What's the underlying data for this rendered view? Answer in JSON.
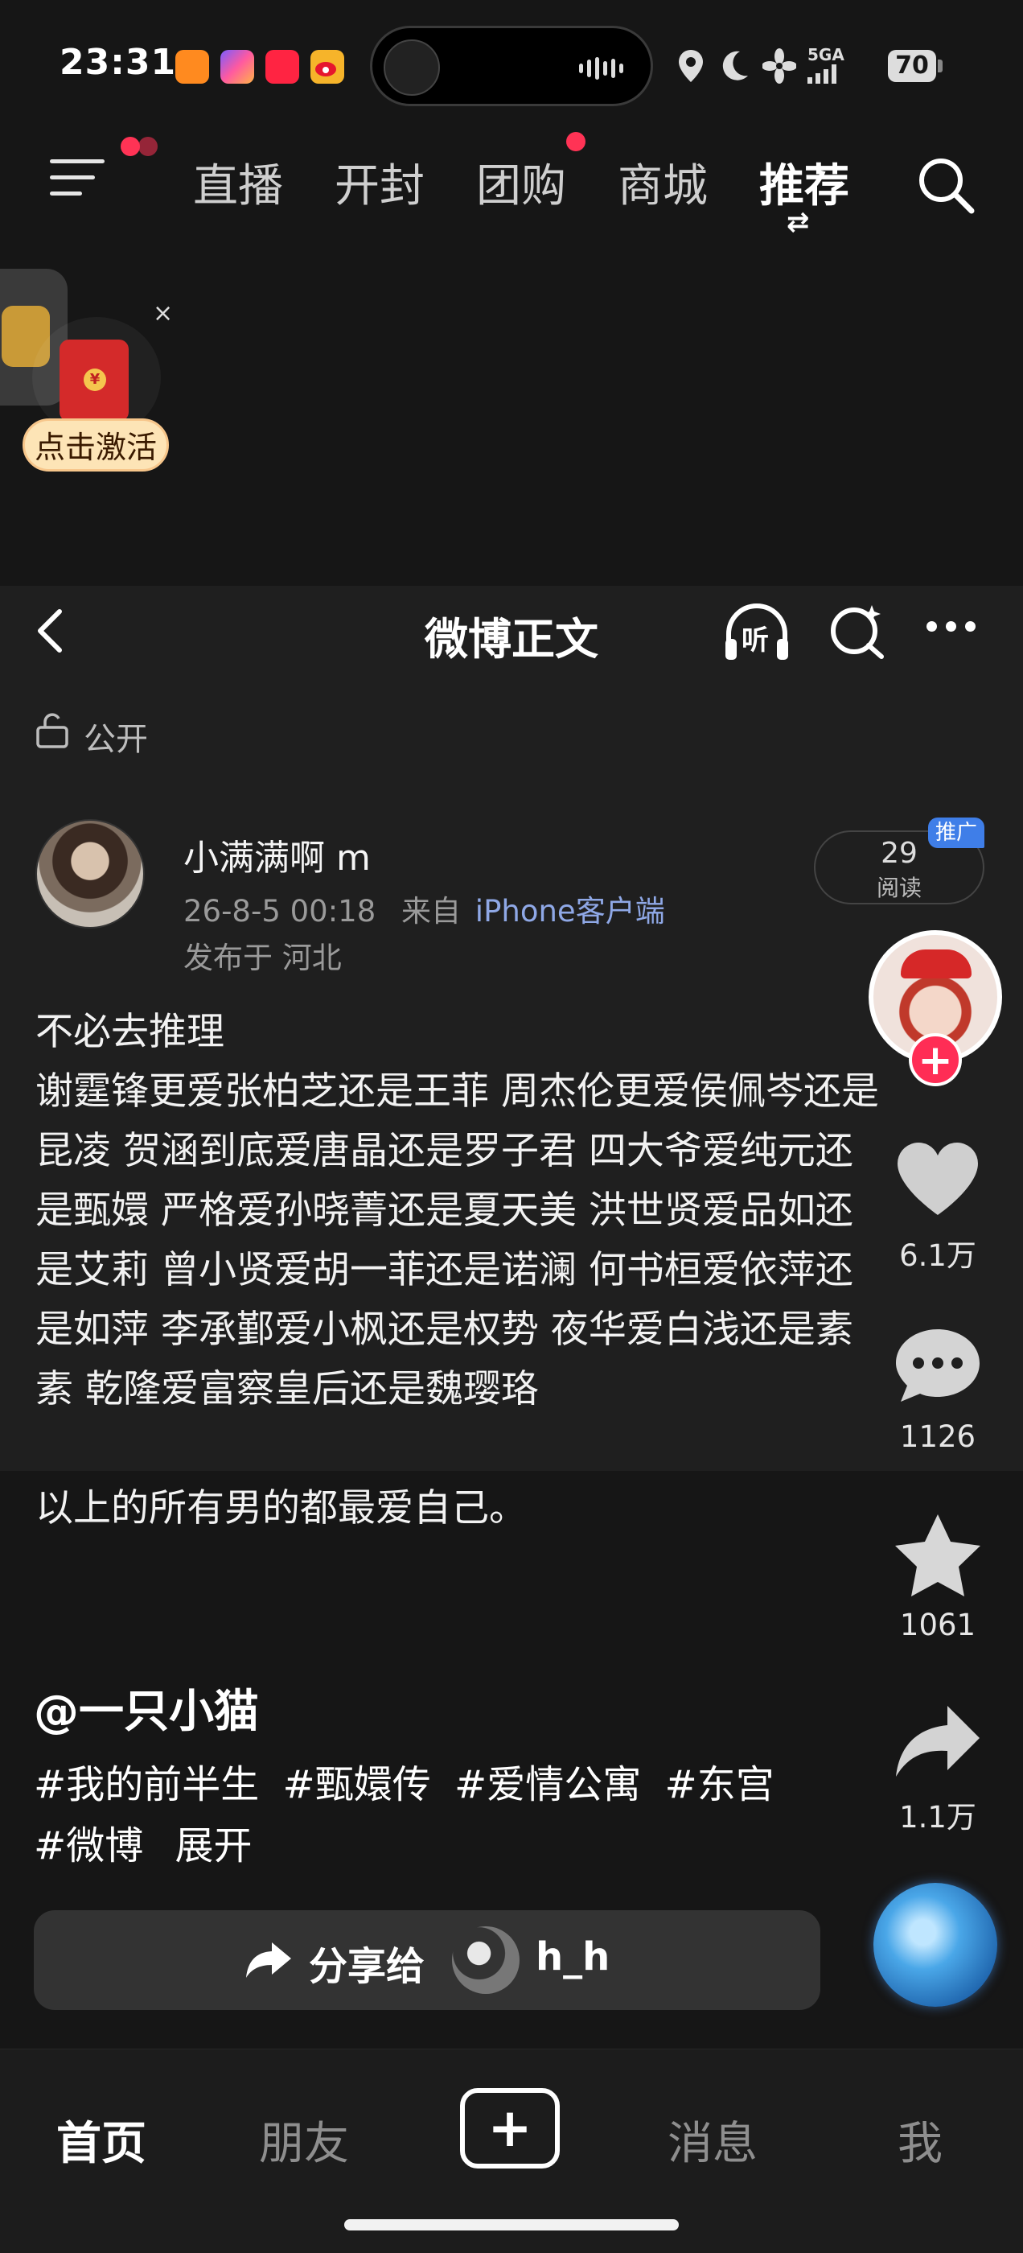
{
  "status_bar": {
    "time": "23:31",
    "network": "5GA",
    "battery": "70"
  },
  "top_nav": {
    "tabs": [
      {
        "label": "直播"
      },
      {
        "label": "开封"
      },
      {
        "label": "团购"
      },
      {
        "label": "商城"
      },
      {
        "label": "推荐"
      }
    ],
    "active_tab": "推荐"
  },
  "promo": {
    "activate_label": "点击激活",
    "close_label": "×"
  },
  "post_header": {
    "title": "微博正文",
    "listen_label": "听"
  },
  "post": {
    "visibility": "公开",
    "author": "小满满啊 m",
    "date": "26-8-5 00:18",
    "source_prefix": "来自",
    "client": "iPhone客户端",
    "location": "发布于 河北",
    "reads_count": "29",
    "reads_label": "阅读",
    "promo_tag": "推广",
    "body_lines": [
      "不必去推理",
      "谢霆锋更爱张柏芝还是王菲 周杰伦更爱侯佩岑还是",
      "昆凌 贺涵到底爱唐晶还是罗子君 四大爷爱纯元还",
      "是甄嬛 严格爱孙晓菁还是夏天美 洪世贤爱品如还",
      "是艾莉 曾小贤爱胡一菲还是诺澜 何书桓爱依萍还",
      "是如萍 李承鄞爱小枫还是权势 夜华爱白浅还是素",
      "素 乾隆爱富察皇后还是魏璎珞"
    ],
    "conclusion": "以上的所有男的都最爱自己。"
  },
  "side_rail": {
    "likes": "6.1万",
    "comments": "1126",
    "favorites": "1061",
    "shares": "1.1万"
  },
  "tags": {
    "mention": "@一只小猫",
    "hashtags": [
      "#我的前半生",
      "#甄嬛传",
      "#爱情公寓",
      "#东宫"
    ],
    "hashtags_line2": [
      "#微博"
    ],
    "expand_label": "展开"
  },
  "share": {
    "label": "分享给",
    "user": "h_h"
  },
  "tab_bar": {
    "home": "首页",
    "friends": "朋友",
    "messages": "消息",
    "me": "我"
  }
}
